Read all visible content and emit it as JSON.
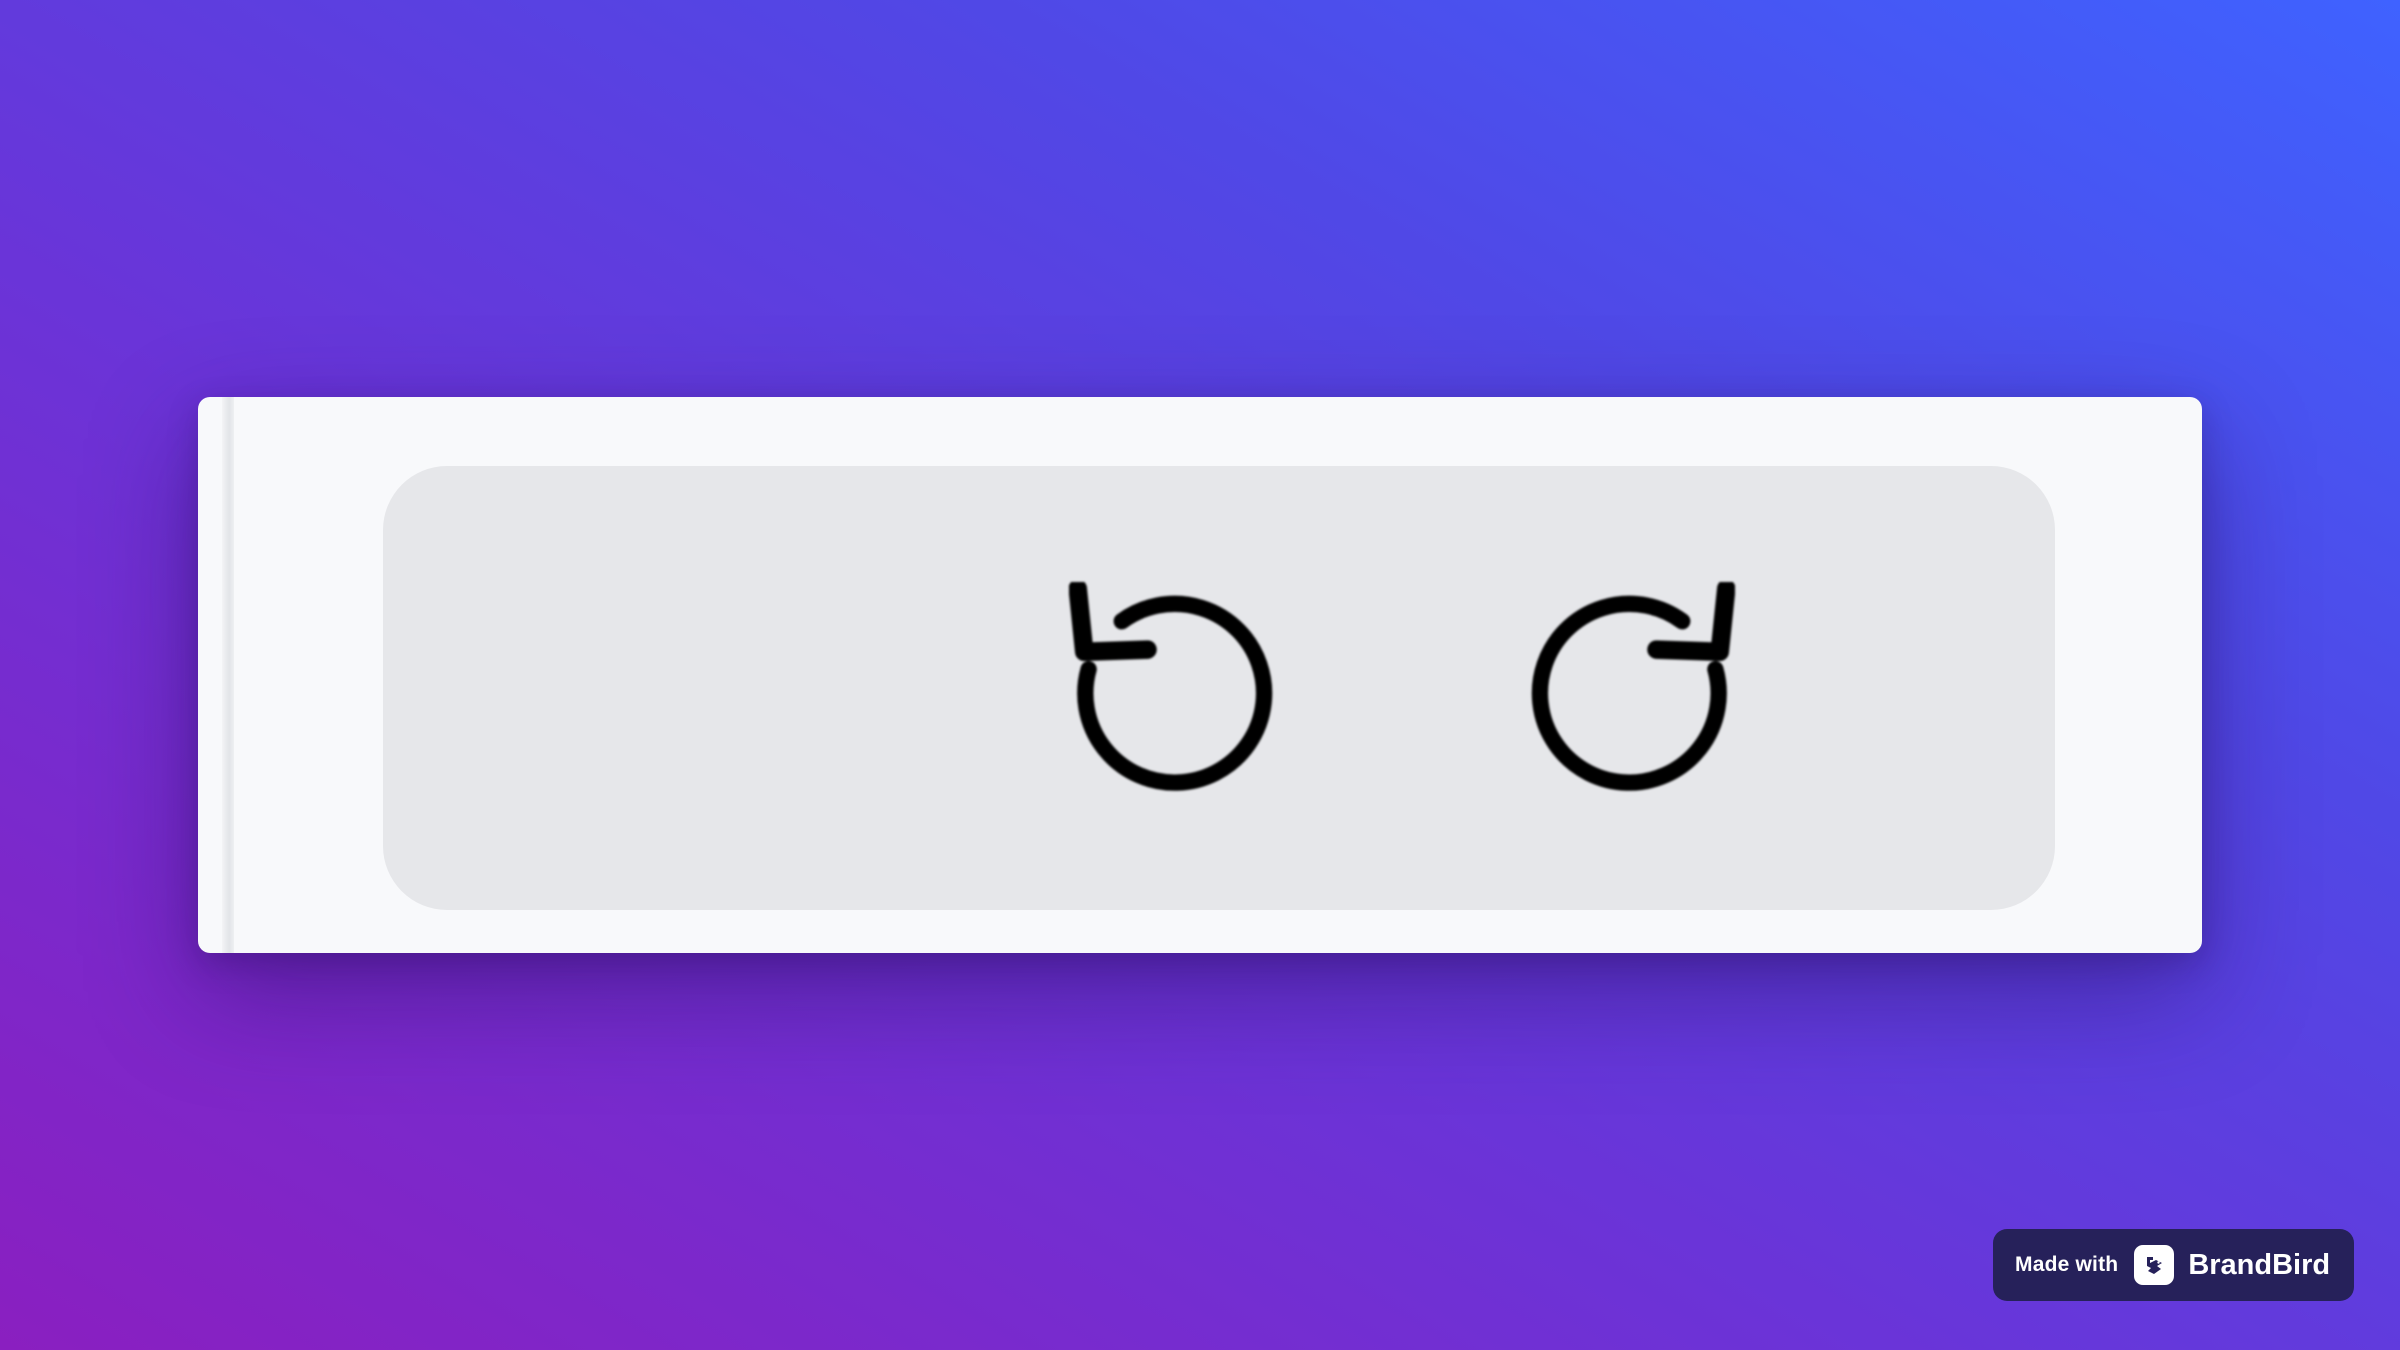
{
  "colors": {
    "background_start": "#8a1fc0",
    "background_end": "#3f62ff",
    "card": "#f8f9fb",
    "toolbar": "#e6e7ea",
    "icon": "#000000",
    "badge": "#26215a"
  },
  "toolbar": {
    "buttons": [
      {
        "name": "undo",
        "icon": "undo-icon"
      },
      {
        "name": "redo",
        "icon": "redo-icon"
      }
    ]
  },
  "badge": {
    "made_with": "Made with",
    "brand": "BrandBird",
    "logo_icon": "brandbird-logo-icon"
  }
}
